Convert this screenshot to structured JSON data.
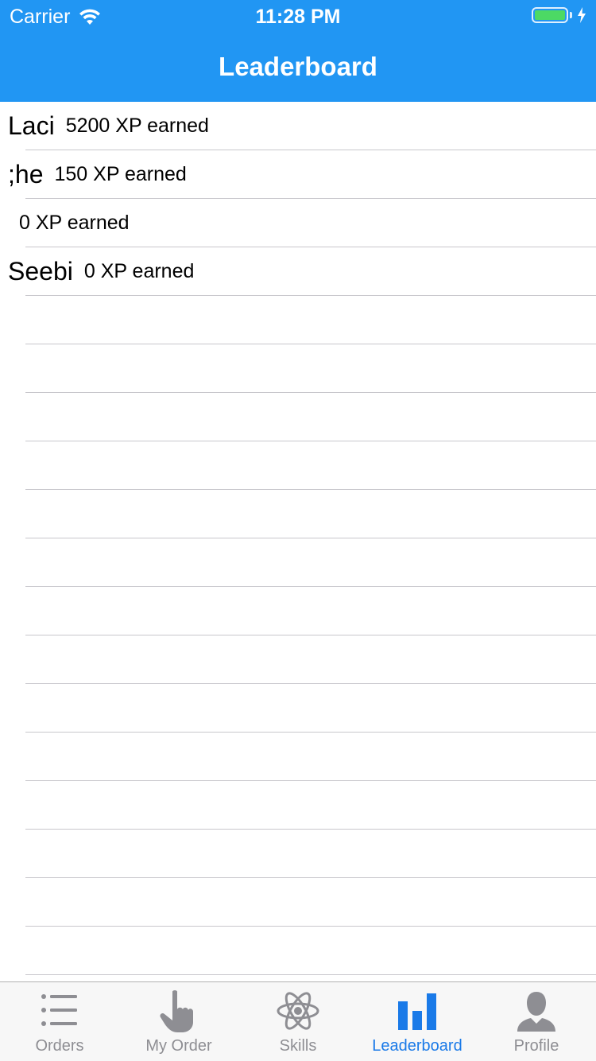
{
  "status_bar": {
    "carrier": "Carrier",
    "time": "11:28 PM",
    "battery_level": 1.0
  },
  "nav": {
    "title": "Leaderboard"
  },
  "leaderboard": {
    "entries": [
      {
        "name": "Laci",
        "xp": "5200 XP earned"
      },
      {
        "name": ";he",
        "xp": "150 XP earned"
      },
      {
        "name": "",
        "xp": "0 XP earned"
      },
      {
        "name": "Seebi",
        "xp": "0 XP earned"
      }
    ]
  },
  "tabbar": {
    "items": [
      {
        "label": "Orders",
        "icon": "list-icon",
        "active": false
      },
      {
        "label": "My Order",
        "icon": "pointing-hand-icon",
        "active": false
      },
      {
        "label": "Skills",
        "icon": "atom-icon",
        "active": false
      },
      {
        "label": "Leaderboard",
        "icon": "bar-chart-icon",
        "active": true
      },
      {
        "label": "Profile",
        "icon": "person-icon",
        "active": false
      }
    ]
  },
  "colors": {
    "nav_background": "#2196f3",
    "active_tab": "#1a7ae8",
    "inactive_tab": "#8e8e93",
    "battery": "#4cd964",
    "separator": "#c8c7cc"
  }
}
